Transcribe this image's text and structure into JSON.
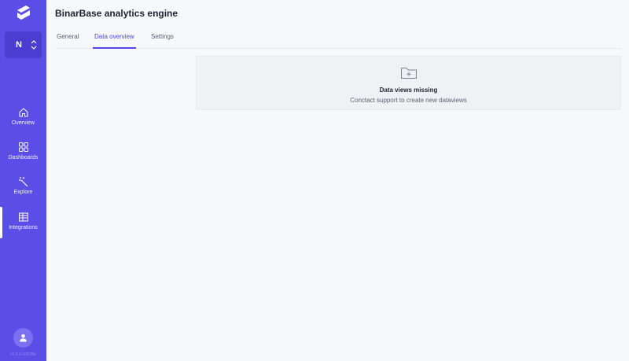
{
  "app": {
    "title": "BinarBase analytics engine"
  },
  "workspace": {
    "letter": "N"
  },
  "sidebar": {
    "items": [
      {
        "label": "Overview",
        "icon": "home-icon"
      },
      {
        "label": "Dashboards",
        "icon": "grid-icon"
      },
      {
        "label": "Explore",
        "icon": "magic-wand-icon"
      },
      {
        "label": "Integrations",
        "icon": "table-icon",
        "active": true
      }
    ],
    "version": "v1.0.0-0057f8e"
  },
  "tabs": [
    {
      "label": "General"
    },
    {
      "label": "Data overview",
      "active": true
    },
    {
      "label": "Settings"
    }
  ],
  "empty_state": {
    "icon": "folder-plus-icon",
    "title": "Data views missing",
    "message": "Conctact support to create new dataviews"
  },
  "colors": {
    "sidebar": "#5b4ee6",
    "accent": "#4f46e5",
    "background": "#f7f8fb"
  }
}
